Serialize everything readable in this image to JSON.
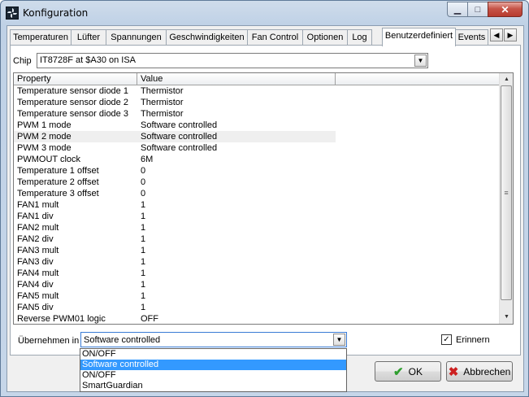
{
  "window": {
    "title": "Konfiguration",
    "caption": {
      "minimize": "▁",
      "maximize": "□",
      "close": "✕"
    }
  },
  "tabs": [
    {
      "label": "Temperaturen"
    },
    {
      "label": "Lüfter"
    },
    {
      "label": "Spannungen"
    },
    {
      "label": "Geschwindigkeiten"
    },
    {
      "label": "Fan Control"
    },
    {
      "label": "Optionen"
    },
    {
      "label": "Log"
    },
    {
      "label": "Benutzerdefiniert",
      "selected": true
    },
    {
      "label": "Events"
    }
  ],
  "tab_scroll": {
    "left": "◀",
    "right": "▶"
  },
  "chip": {
    "label": "Chip",
    "value": "IT8728F at $A30 on ISA"
  },
  "grid": {
    "columns": [
      "Property",
      "Value",
      ""
    ],
    "rows": [
      [
        "Temperature sensor diode 1",
        "Thermistor"
      ],
      [
        "Temperature sensor diode 2",
        "Thermistor"
      ],
      [
        "Temperature sensor diode 3",
        "Thermistor"
      ],
      [
        "PWM 1 mode",
        "Software controlled"
      ],
      [
        "PWM 2 mode",
        "Software controlled"
      ],
      [
        "PWM 3 mode",
        "Software controlled"
      ],
      [
        "PWMOUT clock",
        "6M"
      ],
      [
        "Temperature 1 offset",
        "0"
      ],
      [
        "Temperature 2 offset",
        "0"
      ],
      [
        "Temperature 3 offset",
        "0"
      ],
      [
        "FAN1 mult",
        "1"
      ],
      [
        "FAN1 div",
        "1"
      ],
      [
        "FAN2 mult",
        "1"
      ],
      [
        "FAN2 div",
        "1"
      ],
      [
        "FAN3 mult",
        "1"
      ],
      [
        "FAN3 div",
        "1"
      ],
      [
        "FAN4 mult",
        "1"
      ],
      [
        "FAN4 div",
        "1"
      ],
      [
        "FAN5 mult",
        "1"
      ],
      [
        "FAN5 div",
        "1"
      ],
      [
        "Reverse PWM01 logic",
        "OFF"
      ]
    ],
    "highlighted_row": 4,
    "scroll": {
      "up": "▲",
      "down": "▼",
      "grip": "≡"
    }
  },
  "apply": {
    "label": "Übernehmen in",
    "value": "Software controlled",
    "options": [
      "ON/OFF",
      "Software controlled",
      "ON/OFF",
      "SmartGuardian"
    ],
    "selected_option": 1
  },
  "remember": {
    "label": "Erinnern",
    "checked": true,
    "mark": "✓"
  },
  "buttons": {
    "ok": {
      "label": "OK",
      "icon": "✔",
      "icon_color": "#2e9e2e"
    },
    "cancel": {
      "label": "Abbrechen",
      "icon": "✖",
      "icon_color": "#cc2020"
    }
  },
  "combo_arrow": "▼"
}
